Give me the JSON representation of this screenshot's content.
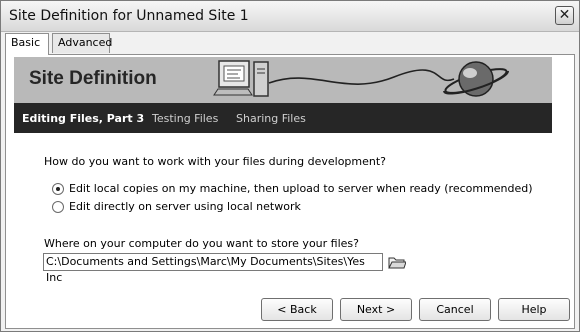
{
  "window": {
    "title": "Site Definition for Unnamed Site 1",
    "close_glyph": "✕"
  },
  "tabs": [
    {
      "label": "Basic",
      "active": true
    },
    {
      "label": "Advanced",
      "active": false
    }
  ],
  "banner": {
    "title": "Site Definition",
    "art_icons": [
      "computer-icon",
      "globe-icon"
    ]
  },
  "steps": [
    {
      "label": "Editing Files, Part 3",
      "current": true
    },
    {
      "label": "Testing Files",
      "current": false
    },
    {
      "label": "Sharing Files",
      "current": false
    }
  ],
  "question1": "How do you want to work with your files during development?",
  "options": [
    {
      "label": "Edit local copies on my machine, then upload to server when ready (recommended)",
      "selected": true
    },
    {
      "label": "Edit directly on server using local network",
      "selected": false
    }
  ],
  "question2": "Where on your computer do you want to store your files?",
  "path_value": "C:\\Documents and Settings\\Marc\\My Documents\\Sites\\Yes Inc",
  "buttons": {
    "back": "< Back",
    "next": "Next >",
    "cancel": "Cancel",
    "help": "Help"
  }
}
